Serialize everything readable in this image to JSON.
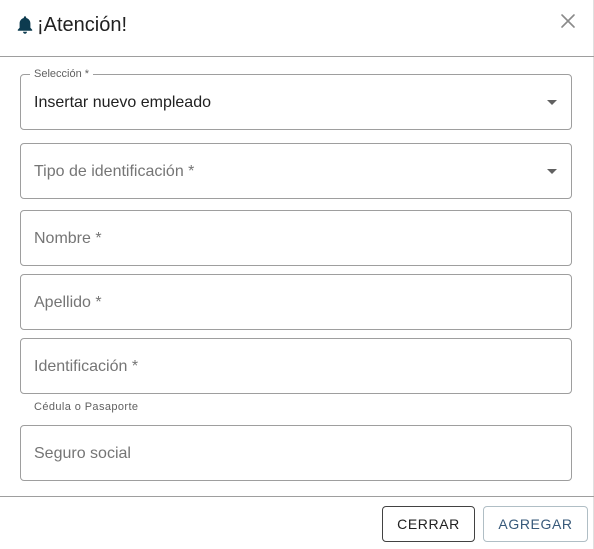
{
  "dialog": {
    "title": "¡Atención!",
    "icon": "bell-icon",
    "close_icon": "close-icon"
  },
  "form": {
    "seleccion": {
      "label": "Selección *",
      "value": "Insertar nuevo empleado"
    },
    "tipo_identificacion": {
      "placeholder": "Tipo de identificación *"
    },
    "nombre": {
      "placeholder": "Nombre *"
    },
    "apellido": {
      "placeholder": "Apellido *"
    },
    "identificacion": {
      "placeholder": "Identificación *",
      "helper": "Cédula o Pasaporte"
    },
    "seguro_social": {
      "placeholder": "Seguro social"
    }
  },
  "footer": {
    "close_label": "CERRAR",
    "add_label": "AGREGAR"
  },
  "colors": {
    "bell": "#0d3b4f",
    "add_text": "#37597a",
    "border": "#9e9e9e"
  }
}
